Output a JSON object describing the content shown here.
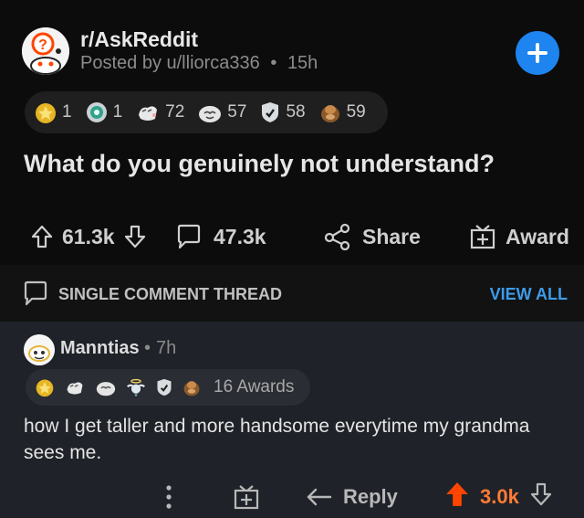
{
  "post": {
    "subreddit": "r/AskReddit",
    "posted_by": "Posted by u/lliorca336",
    "separator": "•",
    "age": "15h",
    "title": "What do you genuinely not understand?",
    "awards": [
      {
        "icon": "gold-award-icon",
        "count": "1"
      },
      {
        "icon": "platinum-award-icon",
        "count": "1"
      },
      {
        "icon": "wholesome-award-icon",
        "count": "72"
      },
      {
        "icon": "silver-award-icon",
        "count": "57"
      },
      {
        "icon": "helpful-award-icon",
        "count": "58"
      },
      {
        "icon": "facepalm-award-icon",
        "count": "59"
      }
    ],
    "upvotes": "61.3k",
    "comments": "47.3k",
    "share_label": "Share",
    "award_label": "Award"
  },
  "thread": {
    "label": "SINGLE COMMENT THREAD",
    "view_all": "VIEW ALL"
  },
  "comment": {
    "user": "Manntias",
    "separator": "•",
    "age": "7h",
    "awards_label": "16 Awards",
    "award_icons": [
      "gold-award-icon",
      "wholesome-award-icon",
      "silver-award-icon",
      "angel-award-icon",
      "helpful-award-icon",
      "facepalm-award-icon"
    ],
    "body": "how I get taller and more handsome everytime my grandma sees me.",
    "reply_label": "Reply",
    "score": "3.0k"
  },
  "colors": {
    "accent_blue": "#1d84f0",
    "link_blue": "#3d9be9",
    "upvote_orange": "#ff4500",
    "score_orange": "#ff7b36"
  }
}
